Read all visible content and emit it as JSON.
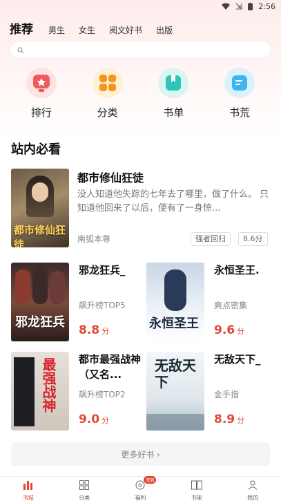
{
  "status_bar": {
    "time": "2:56"
  },
  "tabs": [
    {
      "label": "推荐",
      "active": true
    },
    {
      "label": "男生",
      "active": false
    },
    {
      "label": "女生",
      "active": false
    },
    {
      "label": "阅文好书",
      "active": false
    },
    {
      "label": "出版",
      "active": false
    }
  ],
  "search": {
    "placeholder": "",
    "icon": "search-icon"
  },
  "categories": [
    {
      "label": "排行",
      "icon": "trophy-icon",
      "color": "#f05a5a"
    },
    {
      "label": "分类",
      "icon": "grid-icon",
      "color": "#f7941d"
    },
    {
      "label": "书单",
      "icon": "book-list-icon",
      "color": "#2ec4b6"
    },
    {
      "label": "书荒",
      "icon": "chat-icon",
      "color": "#3bb6f0"
    }
  ],
  "section_title": "站内必看",
  "featured": {
    "title": "都市修仙狂徒",
    "description": "没人知道他失踪的七年去了哪里，做了什么。 只知道他回来了以后，便有了一身惊...",
    "author": "南狐本尊",
    "tag": "强者回归",
    "score": "8.6分",
    "cover_text": "都市修仙狂徒"
  },
  "books": [
    {
      "title": "邪龙狂兵_",
      "meta": "飙升榜TOP5",
      "score": "8.8",
      "unit": "分",
      "cover_text": "邪龙狂兵"
    },
    {
      "title": "永恒圣王.",
      "meta": "爽点密集",
      "score": "9.6",
      "unit": "分",
      "cover_text": "永恒圣王"
    },
    {
      "title": "都市最强战神（又名...",
      "meta": "飙升榜TOP2",
      "score": "9.0",
      "unit": "分",
      "cover_text": "最强战神"
    },
    {
      "title": "无敌天下_",
      "meta": "金手指",
      "score": "8.9",
      "unit": "分",
      "cover_text": "无敌天下"
    }
  ],
  "more_button": "更多好书 ›",
  "bottom_nav": [
    {
      "label": "书城",
      "icon": "bookstore-icon",
      "active": true
    },
    {
      "label": "分类",
      "icon": "grid-icon",
      "active": false
    },
    {
      "label": "福利",
      "icon": "gift-icon",
      "active": false,
      "badge": "签到"
    },
    {
      "label": "书架",
      "icon": "bookshelf-icon",
      "active": false
    },
    {
      "label": "我的",
      "icon": "user-icon",
      "active": false
    }
  ]
}
